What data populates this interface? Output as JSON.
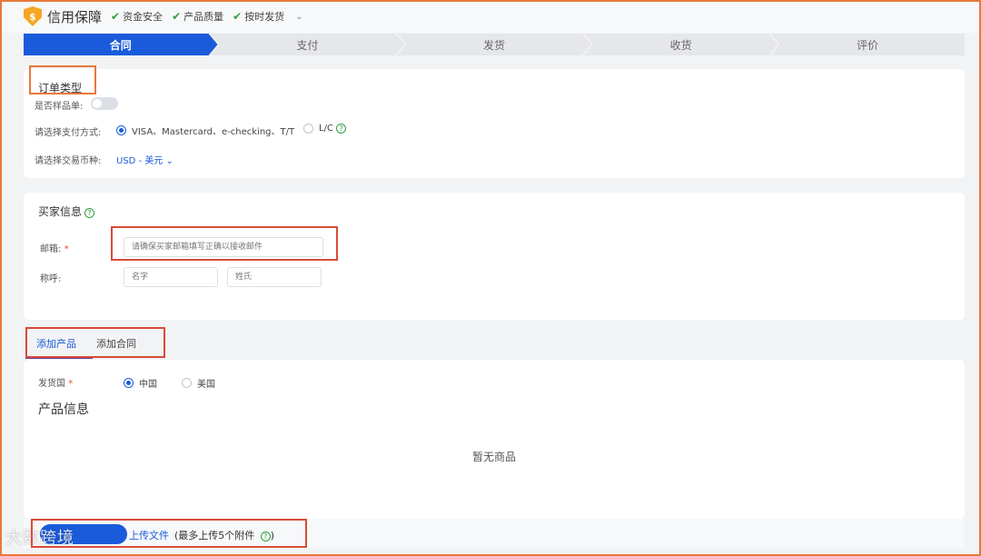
{
  "header": {
    "brand": "信用保障",
    "shield_glyph": "$",
    "guarantees": [
      "资金安全",
      "产品质量",
      "按时发货"
    ]
  },
  "steps": [
    {
      "label": "合同",
      "active": true
    },
    {
      "label": "支付",
      "active": false
    },
    {
      "label": "发货",
      "active": false
    },
    {
      "label": "收货",
      "active": false
    },
    {
      "label": "评价",
      "active": false
    }
  ],
  "order_type": {
    "title": "订单类型",
    "sample_label": "是否样品单:",
    "payment_label": "请选择支付方式:",
    "payment_options": [
      "VISA、Mastercard、e-checking、T/T",
      "L/C"
    ],
    "currency_label": "请选择交易币种:",
    "currency_value": "USD - 美元"
  },
  "buyer": {
    "title": "买家信息",
    "email_label": "邮箱:",
    "email_required": "*",
    "email_placeholder": "请确保买家邮箱填写正确以接收邮件",
    "name_label": "称呼:",
    "first_name_placeholder": "名字",
    "last_name_placeholder": "姓氏"
  },
  "tabs": [
    "添加产品",
    "添加合同"
  ],
  "product": {
    "ship_country_label": "发货国",
    "ship_required": "*",
    "countries": [
      "中国",
      "美国"
    ],
    "title": "产品信息",
    "empty_text": "暂无商品"
  },
  "footer": {
    "upload_label": "上传文件",
    "upload_note": "(最多上传5个附件",
    "upload_note_close": ")",
    "watermark": "大数跨境"
  },
  "colors": {
    "primary": "#1a5bdb",
    "check_green": "#2e9e3f",
    "annotation_red": "#d94b39",
    "annotation_orange": "#e8783a"
  }
}
